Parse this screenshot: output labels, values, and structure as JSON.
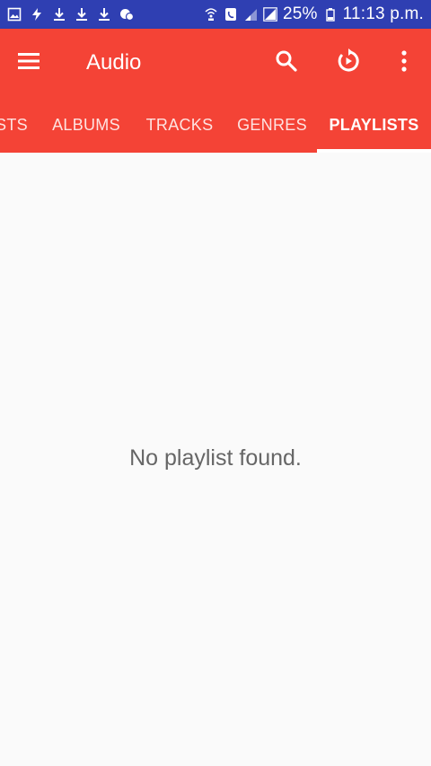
{
  "status_bar": {
    "battery": "25%",
    "time": "11:13 p.m.",
    "left_icons": [
      "gallery-icon",
      "flash-icon",
      "download-icon",
      "download-icon",
      "download-icon",
      "chat-icon"
    ],
    "right_icons": [
      "wifi-call-icon",
      "sim-icon",
      "signal-icon",
      "signal-icon",
      "battery-icon"
    ]
  },
  "app_bar": {
    "title": "Audio",
    "color": "#f44336",
    "menu_icon": "menu-icon",
    "actions": [
      "search-icon",
      "replay-icon",
      "more-vert-icon"
    ]
  },
  "tabs": {
    "items": [
      {
        "label": "STS",
        "active": false
      },
      {
        "label": "ALBUMS",
        "active": false
      },
      {
        "label": "TRACKS",
        "active": false
      },
      {
        "label": "GENRES",
        "active": false
      },
      {
        "label": "PLAYLISTS",
        "active": true
      }
    ]
  },
  "content": {
    "empty_message": "No playlist found."
  }
}
